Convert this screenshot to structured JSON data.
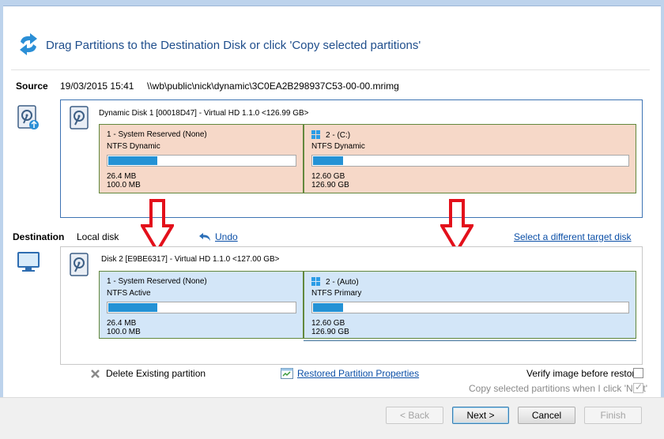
{
  "header": {
    "title": "Drag Partitions to the Destination Disk or click 'Copy selected partitions'"
  },
  "source": {
    "label": "Source",
    "date": "19/03/2015 15:41",
    "path": "\\\\wb\\public\\nick\\dynamic\\3C0EA2B298937C53-00-00.mrimg",
    "disk_title": "Dynamic Disk 1 [00018D47] - Virtual HD 1.1.0  <126.99 GB>",
    "partitions": [
      {
        "name": "1 - System Reserved (None)",
        "fs": "NTFS Dynamic",
        "used": "26.4 MB",
        "total": "100.0 MB",
        "usage": 0.27
      },
      {
        "name": "2 -  (C:)",
        "fs": "NTFS Dynamic",
        "used": "12.60 GB",
        "total": "126.90 GB",
        "usage": 0.1
      }
    ]
  },
  "destination": {
    "label": "Destination",
    "disk_type": "Local disk",
    "undo_label": "Undo",
    "select_target_label": "Select a different target disk",
    "disk_title": "Disk 2 [E9BE6317] - Virtual HD 1.1.0  <127.00 GB>",
    "partitions": [
      {
        "name": "1 - System Reserved (None)",
        "fs": "NTFS Active",
        "used": "26.4 MB",
        "total": "100.0 MB",
        "usage": 0.27
      },
      {
        "name": "2 -  (Auto)",
        "fs": "NTFS Primary",
        "used": "12.60 GB",
        "total": "126.90 GB",
        "usage": 0.1
      }
    ]
  },
  "options": {
    "delete_label": "Delete Existing partition",
    "properties_label": "Restored Partition Properties",
    "verify_label": "Verify image before restore",
    "verify_checked": false,
    "copy_label": "Copy selected partitions when I click 'Next'",
    "copy_checked": true
  },
  "buttons": {
    "back": "< Back",
    "next": "Next >",
    "cancel": "Cancel",
    "finish": "Finish"
  },
  "colors": {
    "arrow": "#e3101b",
    "source_partition": "#f6d8c8",
    "dest_partition": "#d3e6f8",
    "usage_fill": "#2492d5",
    "title": "#1f4e8c",
    "link": "#0b4fa7"
  },
  "icons": [
    "refresh-arrows-icon",
    "hard-disk-icon",
    "monitor-icon",
    "windows-logo-icon",
    "undo-icon",
    "delete-x-icon",
    "properties-icon",
    "arrow-down-icon"
  ]
}
